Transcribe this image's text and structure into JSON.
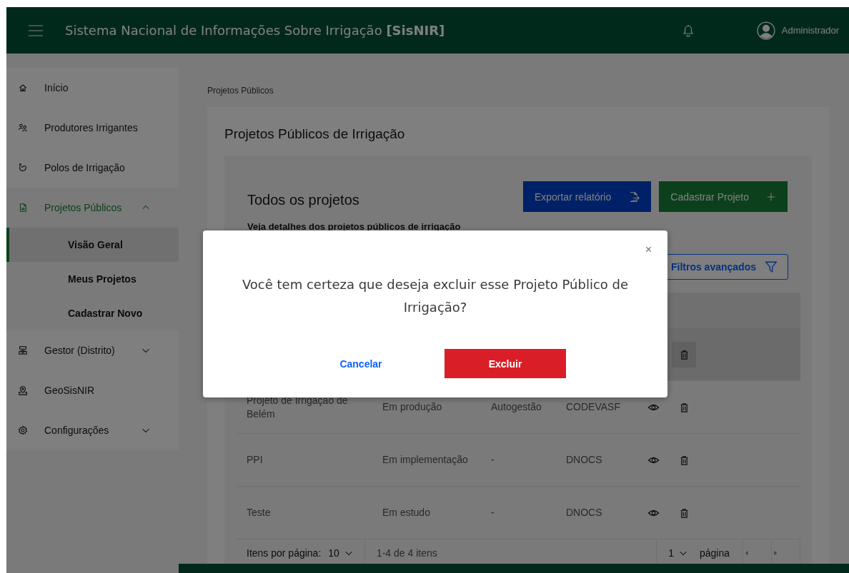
{
  "header": {
    "title": "Sistema Nacional de Informações Sobre Irrigação **[SisNIR]**",
    "user": "Administrador"
  },
  "sidebar": {
    "items": [
      {
        "label": "Início",
        "kind": "link",
        "selected": false
      },
      {
        "label": "Produtores Irrigantes",
        "kind": "link",
        "selected": false
      },
      {
        "label": "Polos de Irrigação",
        "kind": "link",
        "selected": false
      },
      {
        "label": "Projetos Públicos",
        "kind": "group",
        "selected": true,
        "expanded": true,
        "children": [
          {
            "label": "Visão Geral",
            "selected": true
          },
          {
            "label": "Meus Projetos",
            "selected": false
          },
          {
            "label": "Cadastrar Novo",
            "selected": false
          }
        ]
      },
      {
        "label": "Gestor (Distrito)",
        "kind": "group",
        "selected": false,
        "expanded": false
      },
      {
        "label": "GeoSisNIR",
        "kind": "link",
        "selected": false
      },
      {
        "label": "Configurações",
        "kind": "group",
        "selected": false,
        "expanded": false
      }
    ]
  },
  "breadcrumb": "Projetos Públicos",
  "page_title": "Projetos Públicos de Irrigação",
  "panel": {
    "title": "Todos os projetos",
    "subtitle": "Veja detalhes dos projetos públicos de irrigação",
    "export_button": "Exportar relatório",
    "create_button": "Cadastrar Projeto",
    "filter_button": "Filtros avançados"
  },
  "table": {
    "rows": [
      {
        "hovered": true
      },
      {
        "hovered": false,
        "cells": [
          "Projeto de Irrigação de Belém",
          "Em produção",
          "Autogestão",
          "CODEVASF"
        ]
      },
      {
        "hovered": false,
        "cells": [
          "PPI",
          "Em implementação",
          "-",
          "DNOCS"
        ]
      },
      {
        "hovered": false,
        "cells": [
          "Teste",
          "Em estudo",
          "-",
          "DNOCS"
        ]
      }
    ]
  },
  "pagination": {
    "per_page_label": "Itens por página:",
    "per_page": "10",
    "range": "1-4 de 4 itens",
    "page": "1",
    "page_label": "página"
  },
  "modal": {
    "message": "Você tem certeza que deseja excluir esse Projeto Público de Irrigação?",
    "close": "×",
    "cancel": "Cancelar",
    "confirm": "Excluir"
  }
}
